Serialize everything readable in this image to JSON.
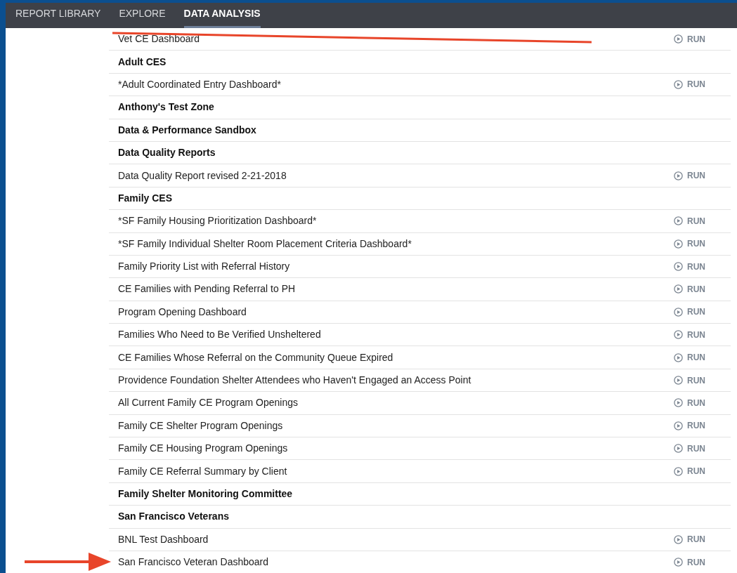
{
  "tabs": [
    {
      "label": "REPORT LIBRARY",
      "selected": false
    },
    {
      "label": "EXPLORE",
      "selected": false
    },
    {
      "label": "DATA ANALYSIS",
      "selected": true
    }
  ],
  "rows": [
    {
      "kind": "report",
      "name": "Vet CE Dashboard",
      "action": "RUN"
    },
    {
      "kind": "group",
      "name": "Adult CES"
    },
    {
      "kind": "report",
      "name": "*Adult Coordinated Entry Dashboard*",
      "action": "RUN"
    },
    {
      "kind": "group",
      "name": "Anthony's Test Zone"
    },
    {
      "kind": "group",
      "name": "Data & Performance Sandbox"
    },
    {
      "kind": "group",
      "name": "Data Quality Reports"
    },
    {
      "kind": "report",
      "name": "Data Quality Report revised 2-21-2018",
      "action": "RUN"
    },
    {
      "kind": "group",
      "name": "Family CES"
    },
    {
      "kind": "report",
      "name": "*SF Family Housing Prioritization Dashboard*",
      "action": "RUN"
    },
    {
      "kind": "report",
      "name": "*SF Family Individual Shelter Room Placement Criteria Dashboard*",
      "action": "RUN"
    },
    {
      "kind": "report",
      "name": "Family Priority List with Referral History",
      "action": "RUN"
    },
    {
      "kind": "report",
      "name": "CE Families with Pending Referral to PH",
      "action": "RUN"
    },
    {
      "kind": "report",
      "name": "Program Opening Dashboard",
      "action": "RUN"
    },
    {
      "kind": "report",
      "name": "Families Who Need to Be Verified Unsheltered",
      "action": "RUN"
    },
    {
      "kind": "report",
      "name": "CE Families Whose Referral on the Community Queue Expired",
      "action": "RUN"
    },
    {
      "kind": "report",
      "name": "Providence Foundation Shelter Attendees who Haven't Engaged an Access Point",
      "action": "RUN"
    },
    {
      "kind": "report",
      "name": "All Current Family CE Program Openings",
      "action": "RUN"
    },
    {
      "kind": "report",
      "name": "Family CE Shelter Program Openings",
      "action": "RUN"
    },
    {
      "kind": "report",
      "name": "Family CE Housing Program Openings",
      "action": "RUN"
    },
    {
      "kind": "report",
      "name": "Family CE Referral Summary by Client",
      "action": "RUN"
    },
    {
      "kind": "group",
      "name": "Family Shelter Monitoring Committee"
    },
    {
      "kind": "group",
      "name": "San Francisco Veterans"
    },
    {
      "kind": "report",
      "name": "BNL Test Dashboard",
      "action": "RUN"
    },
    {
      "kind": "report",
      "name": "San Francisco Veteran Dashboard",
      "action": "RUN"
    }
  ]
}
